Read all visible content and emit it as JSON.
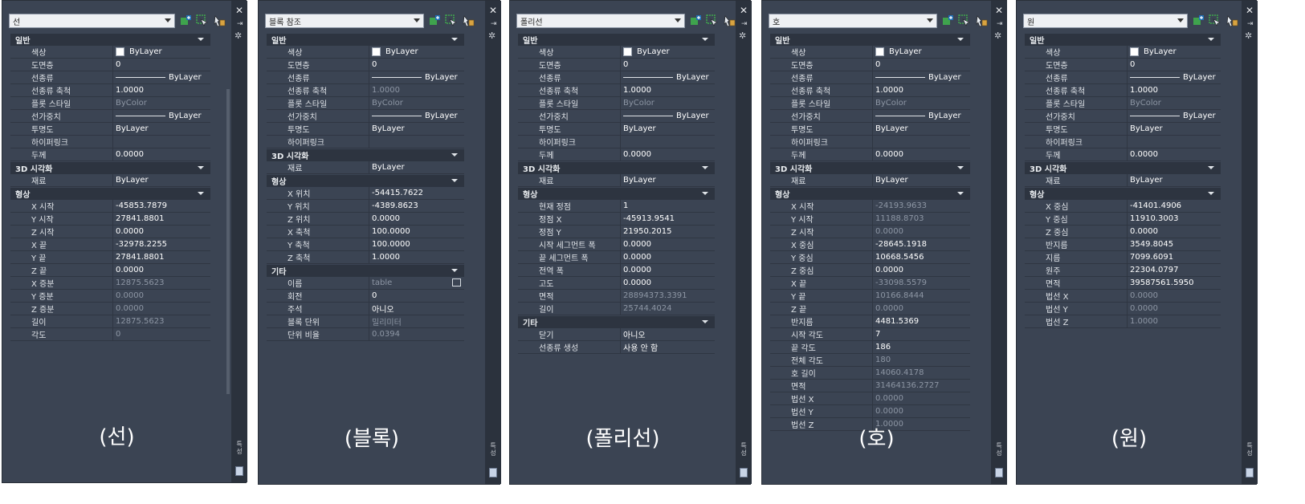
{
  "panels": [
    {
      "combo": "선",
      "caption": "(선)",
      "sections": [
        {
          "title": "일반",
          "rows": [
            {
              "k": "색상",
              "v": "ByLayer",
              "type": "color"
            },
            {
              "k": "도면층",
              "v": "0"
            },
            {
              "k": "선종류",
              "v": "ByLayer",
              "type": "line"
            },
            {
              "k": "선종류 축척",
              "v": "1.0000"
            },
            {
              "k": "플롯 스타일",
              "v": "ByColor",
              "ro": true
            },
            {
              "k": "선가중치",
              "v": "ByLayer",
              "type": "line"
            },
            {
              "k": "투명도",
              "v": "ByLayer"
            },
            {
              "k": "하이퍼링크",
              "v": ""
            },
            {
              "k": "두께",
              "v": "0.0000"
            }
          ]
        },
        {
          "title": "3D 시각화",
          "rows": [
            {
              "k": "재료",
              "v": "ByLayer"
            }
          ]
        },
        {
          "title": "형상",
          "rows": [
            {
              "k": "X 시작",
              "v": "-45853.7879"
            },
            {
              "k": "Y 시작",
              "v": "27841.8801"
            },
            {
              "k": "Z 시작",
              "v": "0.0000"
            },
            {
              "k": "X 끝",
              "v": "-32978.2255"
            },
            {
              "k": "Y 끝",
              "v": "27841.8801"
            },
            {
              "k": "Z 끝",
              "v": "0.0000"
            },
            {
              "k": "X 증분",
              "v": "12875.5623",
              "ro": true
            },
            {
              "k": "Y 증분",
              "v": "0.0000",
              "ro": true
            },
            {
              "k": "Z 증분",
              "v": "0.0000",
              "ro": true
            },
            {
              "k": "길이",
              "v": "12875.5623",
              "ro": true
            },
            {
              "k": "각도",
              "v": "0",
              "ro": true
            }
          ]
        }
      ]
    },
    {
      "combo": "블록 참조",
      "caption": "(블록)",
      "sections": [
        {
          "title": "일반",
          "rows": [
            {
              "k": "색상",
              "v": "ByLayer",
              "type": "color"
            },
            {
              "k": "도면층",
              "v": "0"
            },
            {
              "k": "선종류",
              "v": "ByLayer",
              "type": "line"
            },
            {
              "k": "선종류 축척",
              "v": "1.0000",
              "ro": true
            },
            {
              "k": "플롯 스타일",
              "v": "ByColor",
              "ro": true
            },
            {
              "k": "선가중치",
              "v": "ByLayer",
              "type": "line"
            },
            {
              "k": "투명도",
              "v": "ByLayer"
            },
            {
              "k": "하이퍼링크",
              "v": ""
            }
          ]
        },
        {
          "title": "3D 시각화",
          "rows": [
            {
              "k": "재료",
              "v": "ByLayer"
            }
          ]
        },
        {
          "title": "형상",
          "rows": [
            {
              "k": "X 위치",
              "v": "-54415.7622"
            },
            {
              "k": "Y 위치",
              "v": "-4389.8623"
            },
            {
              "k": "Z 위치",
              "v": "0.0000"
            },
            {
              "k": "X 축척",
              "v": "100.0000"
            },
            {
              "k": "Y 축척",
              "v": "100.0000"
            },
            {
              "k": "Z 축척",
              "v": "1.0000"
            }
          ]
        },
        {
          "title": "기타",
          "rows": [
            {
              "k": "이름",
              "v": "table",
              "ro": true,
              "type": "pick"
            },
            {
              "k": "회전",
              "v": "0"
            },
            {
              "k": "주석",
              "v": "아니오"
            },
            {
              "k": "블록 단위",
              "v": "밀리미터",
              "ro": true
            },
            {
              "k": "단위 비율",
              "v": "0.0394",
              "ro": true
            }
          ]
        }
      ]
    },
    {
      "combo": "폴리선",
      "caption": "(폴리선)",
      "sections": [
        {
          "title": "일반",
          "rows": [
            {
              "k": "색상",
              "v": "ByLayer",
              "type": "color"
            },
            {
              "k": "도면층",
              "v": "0"
            },
            {
              "k": "선종류",
              "v": "ByLayer",
              "type": "line"
            },
            {
              "k": "선종류 축척",
              "v": "1.0000"
            },
            {
              "k": "플롯 스타일",
              "v": "ByColor",
              "ro": true
            },
            {
              "k": "선가중치",
              "v": "ByLayer",
              "type": "line"
            },
            {
              "k": "투명도",
              "v": "ByLayer"
            },
            {
              "k": "하이퍼링크",
              "v": ""
            },
            {
              "k": "두께",
              "v": "0.0000"
            }
          ]
        },
        {
          "title": "3D 시각화",
          "rows": [
            {
              "k": "재료",
              "v": "ByLayer"
            }
          ]
        },
        {
          "title": "형상",
          "rows": [
            {
              "k": "현재 정점",
              "v": "1"
            },
            {
              "k": "정점 X",
              "v": "-45913.9541"
            },
            {
              "k": "정점 Y",
              "v": "21950.2015"
            },
            {
              "k": "시작 세그먼트 폭",
              "v": "0.0000"
            },
            {
              "k": "끝 세그먼트 폭",
              "v": "0.0000"
            },
            {
              "k": "전역 폭",
              "v": "0.0000"
            },
            {
              "k": "고도",
              "v": "0.0000"
            },
            {
              "k": "면적",
              "v": "28894373.3391",
              "ro": true
            },
            {
              "k": "길이",
              "v": "25744.4024",
              "ro": true
            }
          ]
        },
        {
          "title": "기타",
          "rows": [
            {
              "k": "닫기",
              "v": "아니오"
            },
            {
              "k": "선종류 생성",
              "v": "사용 안 함"
            }
          ]
        }
      ]
    },
    {
      "combo": "호",
      "caption": "(호)",
      "sections": [
        {
          "title": "일반",
          "rows": [
            {
              "k": "색상",
              "v": "ByLayer",
              "type": "color"
            },
            {
              "k": "도면층",
              "v": "0"
            },
            {
              "k": "선종류",
              "v": "ByLayer",
              "type": "line"
            },
            {
              "k": "선종류 축척",
              "v": "1.0000"
            },
            {
              "k": "플롯 스타일",
              "v": "ByColor",
              "ro": true
            },
            {
              "k": "선가중치",
              "v": "ByLayer",
              "type": "line"
            },
            {
              "k": "투명도",
              "v": "ByLayer"
            },
            {
              "k": "하이퍼링크",
              "v": ""
            },
            {
              "k": "두께",
              "v": "0.0000"
            }
          ]
        },
        {
          "title": "3D 시각화",
          "rows": [
            {
              "k": "재료",
              "v": "ByLayer"
            }
          ]
        },
        {
          "title": "형상",
          "rows": [
            {
              "k": "X 시작",
              "v": "-24193.9633",
              "ro": true
            },
            {
              "k": "Y 시작",
              "v": "11188.8703",
              "ro": true
            },
            {
              "k": "Z 시작",
              "v": "0.0000",
              "ro": true
            },
            {
              "k": "X 중심",
              "v": "-28645.1918"
            },
            {
              "k": "Y 중심",
              "v": "10668.5456"
            },
            {
              "k": "Z 중심",
              "v": "0.0000"
            },
            {
              "k": "X 끝",
              "v": "-33098.5579",
              "ro": true
            },
            {
              "k": "Y 끝",
              "v": "10166.8444",
              "ro": true
            },
            {
              "k": "Z 끝",
              "v": "0.0000",
              "ro": true
            },
            {
              "k": "반지름",
              "v": "4481.5369"
            },
            {
              "k": "시작 각도",
              "v": "7"
            },
            {
              "k": "끝 각도",
              "v": "186"
            },
            {
              "k": "전체 각도",
              "v": "180",
              "ro": true
            },
            {
              "k": "호 길이",
              "v": "14060.4178",
              "ro": true
            },
            {
              "k": "면적",
              "v": "31464136.2727",
              "ro": true
            },
            {
              "k": "법선 X",
              "v": "0.0000",
              "ro": true
            },
            {
              "k": "법선 Y",
              "v": "0.0000",
              "ro": true
            },
            {
              "k": "법선 Z",
              "v": "1.0000",
              "ro": true
            }
          ]
        }
      ]
    },
    {
      "combo": "원",
      "caption": "(원)",
      "sections": [
        {
          "title": "일반",
          "rows": [
            {
              "k": "색상",
              "v": "ByLayer",
              "type": "color"
            },
            {
              "k": "도면층",
              "v": "0"
            },
            {
              "k": "선종류",
              "v": "ByLayer",
              "type": "line"
            },
            {
              "k": "선종류 축척",
              "v": "1.0000"
            },
            {
              "k": "플롯 스타일",
              "v": "ByColor",
              "ro": true
            },
            {
              "k": "선가중치",
              "v": "ByLayer",
              "type": "line"
            },
            {
              "k": "투명도",
              "v": "ByLayer"
            },
            {
              "k": "하이퍼링크",
              "v": ""
            },
            {
              "k": "두께",
              "v": "0.0000"
            }
          ]
        },
        {
          "title": "3D 시각화",
          "rows": [
            {
              "k": "재료",
              "v": "ByLayer"
            }
          ]
        },
        {
          "title": "형상",
          "rows": [
            {
              "k": "X 중심",
              "v": "-41401.4906"
            },
            {
              "k": "Y 중심",
              "v": "11910.3003"
            },
            {
              "k": "Z 중심",
              "v": "0.0000"
            },
            {
              "k": "반지름",
              "v": "3549.8045"
            },
            {
              "k": "지름",
              "v": "7099.6091"
            },
            {
              "k": "원주",
              "v": "22304.0797"
            },
            {
              "k": "면적",
              "v": "39587561.5950"
            },
            {
              "k": "법선 X",
              "v": "0.0000",
              "ro": true
            },
            {
              "k": "법선 Y",
              "v": "0.0000",
              "ro": true
            },
            {
              "k": "법선 Z",
              "v": "1.0000",
              "ro": true
            }
          ]
        }
      ]
    }
  ],
  "side_strip": {
    "close": "✕",
    "pin": "⇥",
    "gear": "✲",
    "vertical_label": "특성"
  }
}
